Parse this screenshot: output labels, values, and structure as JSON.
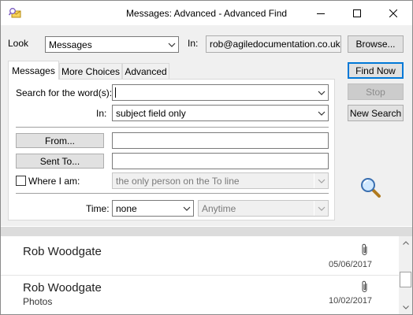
{
  "window": {
    "title": "Messages: Advanced - Advanced Find"
  },
  "toolbar": {
    "look_label": "Look",
    "look_value": "Messages",
    "in_label": "In:",
    "in_value": "rob@agiledocumentation.co.uk",
    "browse_label": "Browse..."
  },
  "tabs": [
    {
      "label": "Messages",
      "active": true
    },
    {
      "label": "More Choices",
      "active": false
    },
    {
      "label": "Advanced",
      "active": false
    }
  ],
  "form": {
    "search_words_label": "Search for the word(s):",
    "search_words_value": "",
    "in_label": "In:",
    "in_value": "subject field only",
    "from_label": "From...",
    "from_value": "",
    "sent_to_label": "Sent To...",
    "sent_to_value": "",
    "where_i_am_label": "Where I am:",
    "where_i_am_checked": false,
    "where_i_am_value": "the only person on the To line",
    "time_label": "Time:",
    "time_value": "none",
    "time_range_value": "Anytime"
  },
  "actions": {
    "find_now": "Find Now",
    "stop": "Stop",
    "new_search": "New Search"
  },
  "results": [
    {
      "sender": "Rob Woodgate",
      "subject": "",
      "date": "05/06/2017",
      "has_attachment": true
    },
    {
      "sender": "Rob Woodgate",
      "subject": "Photos",
      "date": "10/02/2017",
      "has_attachment": true
    }
  ],
  "icons": {
    "app": "outlook-find-icon",
    "magnifier": "search-magnifier-icon",
    "attachment": "paperclip-icon"
  }
}
